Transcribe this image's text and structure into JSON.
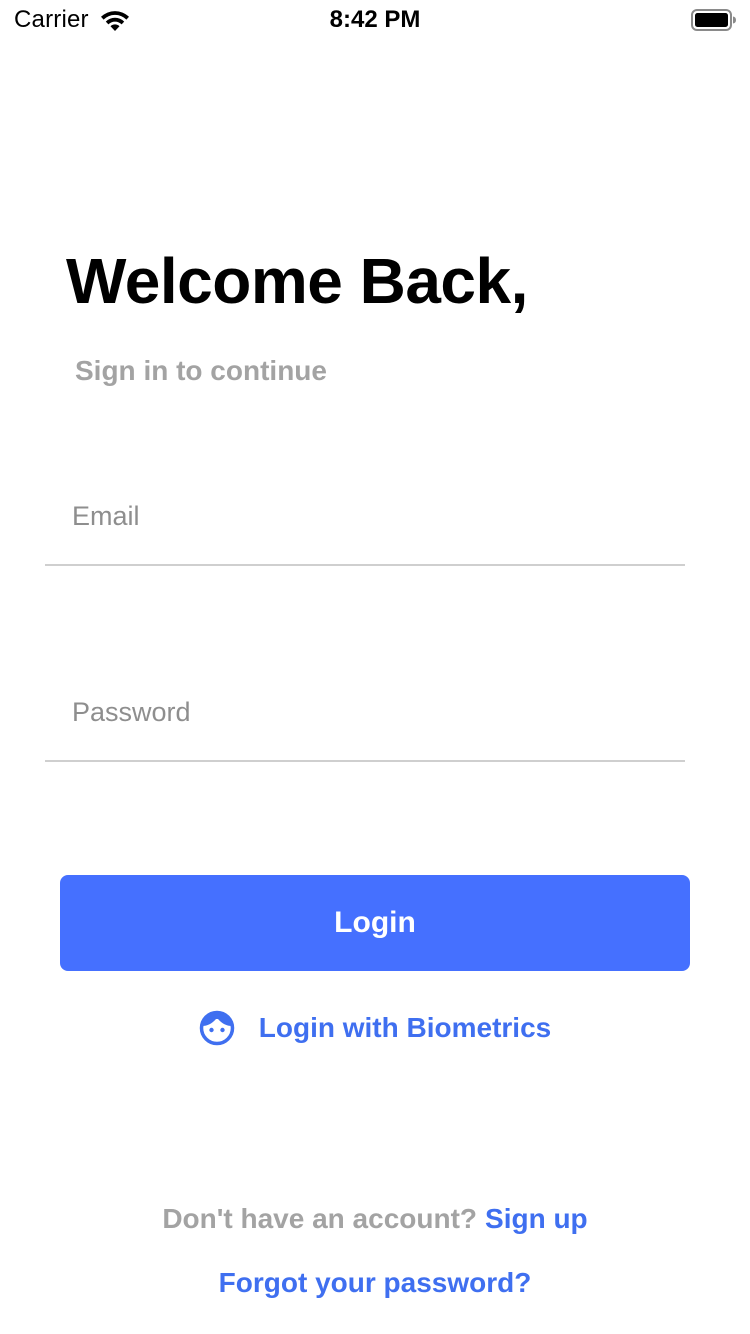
{
  "status_bar": {
    "carrier": "Carrier",
    "time": "8:42 PM",
    "wifi_icon": "wifi-icon",
    "battery_icon": "battery-icon"
  },
  "header": {
    "title": "Welcome Back,",
    "subtitle": "Sign in to continue"
  },
  "form": {
    "email": {
      "placeholder": "Email",
      "value": ""
    },
    "password": {
      "placeholder": "Password",
      "value": ""
    },
    "login_label": "Login",
    "biometrics_label": "Login with Biometrics",
    "biometrics_icon": "face-id-icon"
  },
  "footer": {
    "signup_prompt": "Don't have an account?",
    "signup_link": "Sign up",
    "forgot_password": "Forgot your password?"
  },
  "colors": {
    "accent": "#4570ff",
    "link": "#3f6ff0",
    "muted_text": "#a3a3a3",
    "placeholder": "#8e8e8e"
  }
}
